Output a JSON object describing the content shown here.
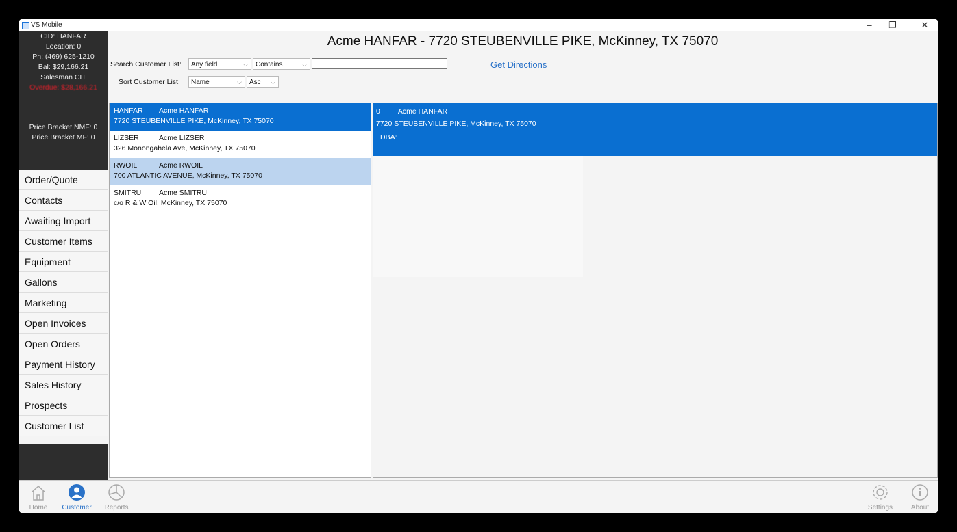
{
  "app": {
    "title": "VS Mobile"
  },
  "window_controls": {
    "minimize": "–",
    "restore": "❐",
    "close": "✕"
  },
  "info": {
    "cid": "CID: HANFAR",
    "location": "Location: 0",
    "phone": "Ph: (469) 625-1210",
    "balance": "Bal: $29,166.21",
    "salesman": "Salesman CIT",
    "overdue": "Overdue: $28,166.21",
    "price_nmf": "Price Bracket NMF: 0",
    "price_mf": "Price Bracket MF: 0"
  },
  "nav": [
    "Order/Quote",
    "Contacts",
    "Awaiting Import",
    "Customer Items",
    "Equipment",
    "Gallons",
    "Marketing",
    "Open Invoices",
    "Open Orders",
    "Payment History",
    "Sales History",
    "Prospects",
    "Customer List"
  ],
  "header": {
    "title": "Acme HANFAR - 7720 STEUBENVILLE PIKE, McKinney, TX 75070"
  },
  "search": {
    "label": "Search Customer List:",
    "field": "Any field",
    "mode": "Contains",
    "value": "",
    "get_directions": "Get Directions"
  },
  "sort": {
    "label": "Sort Customer List:",
    "field": "Name",
    "order": "Asc"
  },
  "customers": [
    {
      "code": "HANFAR",
      "name": "Acme HANFAR",
      "address": "7720 STEUBENVILLE PIKE, McKinney, TX 75070"
    },
    {
      "code": "LIZSER",
      "name": "Acme LIZSER",
      "address": "326 Monongahela Ave, McKinney, TX 75070"
    },
    {
      "code": "RWOIL",
      "name": "Acme RWOIL",
      "address": "700 ATLANTIC AVENUE, McKinney, TX 75070"
    },
    {
      "code": "SMITRU",
      "name": "Acme SMITRU",
      "address": "c/o R & W Oil, McKinney, TX 75070"
    }
  ],
  "detail": {
    "location": "0",
    "name": "Acme HANFAR",
    "address": "7720 STEUBENVILLE PIKE, McKinney, TX 75070",
    "dba": "DBA:"
  },
  "bottom_nav": {
    "home": {
      "label": "Home",
      "icon": "home-icon"
    },
    "customer": {
      "label": "Customer",
      "icon": "customer-icon"
    },
    "reports": {
      "label": "Reports",
      "icon": "reports-icon"
    },
    "settings": {
      "label": "Settings",
      "icon": "gear-icon"
    },
    "about": {
      "label": "About",
      "icon": "info-icon"
    }
  },
  "colors": {
    "accent": "#0a6fd1",
    "hover_row": "#bcd4ef",
    "sidebar_dark": "#2d2d2d",
    "overdue": "#e0202a",
    "link": "#2a72c8"
  }
}
